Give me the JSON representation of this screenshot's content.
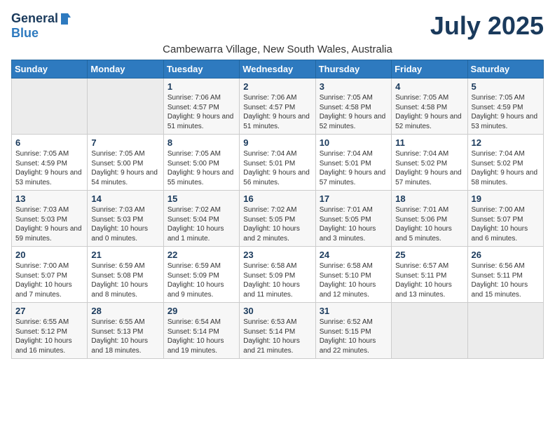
{
  "header": {
    "logo_general": "General",
    "logo_blue": "Blue",
    "month_title": "July 2025",
    "subtitle": "Cambewarra Village, New South Wales, Australia"
  },
  "columns": [
    "Sunday",
    "Monday",
    "Tuesday",
    "Wednesday",
    "Thursday",
    "Friday",
    "Saturday"
  ],
  "weeks": [
    [
      {
        "day": "",
        "info": ""
      },
      {
        "day": "",
        "info": ""
      },
      {
        "day": "1",
        "info": "Sunrise: 7:06 AM\nSunset: 4:57 PM\nDaylight: 9 hours and 51 minutes."
      },
      {
        "day": "2",
        "info": "Sunrise: 7:06 AM\nSunset: 4:57 PM\nDaylight: 9 hours and 51 minutes."
      },
      {
        "day": "3",
        "info": "Sunrise: 7:05 AM\nSunset: 4:58 PM\nDaylight: 9 hours and 52 minutes."
      },
      {
        "day": "4",
        "info": "Sunrise: 7:05 AM\nSunset: 4:58 PM\nDaylight: 9 hours and 52 minutes."
      },
      {
        "day": "5",
        "info": "Sunrise: 7:05 AM\nSunset: 4:59 PM\nDaylight: 9 hours and 53 minutes."
      }
    ],
    [
      {
        "day": "6",
        "info": "Sunrise: 7:05 AM\nSunset: 4:59 PM\nDaylight: 9 hours and 53 minutes."
      },
      {
        "day": "7",
        "info": "Sunrise: 7:05 AM\nSunset: 5:00 PM\nDaylight: 9 hours and 54 minutes."
      },
      {
        "day": "8",
        "info": "Sunrise: 7:05 AM\nSunset: 5:00 PM\nDaylight: 9 hours and 55 minutes."
      },
      {
        "day": "9",
        "info": "Sunrise: 7:04 AM\nSunset: 5:01 PM\nDaylight: 9 hours and 56 minutes."
      },
      {
        "day": "10",
        "info": "Sunrise: 7:04 AM\nSunset: 5:01 PM\nDaylight: 9 hours and 57 minutes."
      },
      {
        "day": "11",
        "info": "Sunrise: 7:04 AM\nSunset: 5:02 PM\nDaylight: 9 hours and 57 minutes."
      },
      {
        "day": "12",
        "info": "Sunrise: 7:04 AM\nSunset: 5:02 PM\nDaylight: 9 hours and 58 minutes."
      }
    ],
    [
      {
        "day": "13",
        "info": "Sunrise: 7:03 AM\nSunset: 5:03 PM\nDaylight: 9 hours and 59 minutes."
      },
      {
        "day": "14",
        "info": "Sunrise: 7:03 AM\nSunset: 5:03 PM\nDaylight: 10 hours and 0 minutes."
      },
      {
        "day": "15",
        "info": "Sunrise: 7:02 AM\nSunset: 5:04 PM\nDaylight: 10 hours and 1 minute."
      },
      {
        "day": "16",
        "info": "Sunrise: 7:02 AM\nSunset: 5:05 PM\nDaylight: 10 hours and 2 minutes."
      },
      {
        "day": "17",
        "info": "Sunrise: 7:01 AM\nSunset: 5:05 PM\nDaylight: 10 hours and 3 minutes."
      },
      {
        "day": "18",
        "info": "Sunrise: 7:01 AM\nSunset: 5:06 PM\nDaylight: 10 hours and 5 minutes."
      },
      {
        "day": "19",
        "info": "Sunrise: 7:00 AM\nSunset: 5:07 PM\nDaylight: 10 hours and 6 minutes."
      }
    ],
    [
      {
        "day": "20",
        "info": "Sunrise: 7:00 AM\nSunset: 5:07 PM\nDaylight: 10 hours and 7 minutes."
      },
      {
        "day": "21",
        "info": "Sunrise: 6:59 AM\nSunset: 5:08 PM\nDaylight: 10 hours and 8 minutes."
      },
      {
        "day": "22",
        "info": "Sunrise: 6:59 AM\nSunset: 5:09 PM\nDaylight: 10 hours and 9 minutes."
      },
      {
        "day": "23",
        "info": "Sunrise: 6:58 AM\nSunset: 5:09 PM\nDaylight: 10 hours and 11 minutes."
      },
      {
        "day": "24",
        "info": "Sunrise: 6:58 AM\nSunset: 5:10 PM\nDaylight: 10 hours and 12 minutes."
      },
      {
        "day": "25",
        "info": "Sunrise: 6:57 AM\nSunset: 5:11 PM\nDaylight: 10 hours and 13 minutes."
      },
      {
        "day": "26",
        "info": "Sunrise: 6:56 AM\nSunset: 5:11 PM\nDaylight: 10 hours and 15 minutes."
      }
    ],
    [
      {
        "day": "27",
        "info": "Sunrise: 6:55 AM\nSunset: 5:12 PM\nDaylight: 10 hours and 16 minutes."
      },
      {
        "day": "28",
        "info": "Sunrise: 6:55 AM\nSunset: 5:13 PM\nDaylight: 10 hours and 18 minutes."
      },
      {
        "day": "29",
        "info": "Sunrise: 6:54 AM\nSunset: 5:14 PM\nDaylight: 10 hours and 19 minutes."
      },
      {
        "day": "30",
        "info": "Sunrise: 6:53 AM\nSunset: 5:14 PM\nDaylight: 10 hours and 21 minutes."
      },
      {
        "day": "31",
        "info": "Sunrise: 6:52 AM\nSunset: 5:15 PM\nDaylight: 10 hours and 22 minutes."
      },
      {
        "day": "",
        "info": ""
      },
      {
        "day": "",
        "info": ""
      }
    ]
  ]
}
